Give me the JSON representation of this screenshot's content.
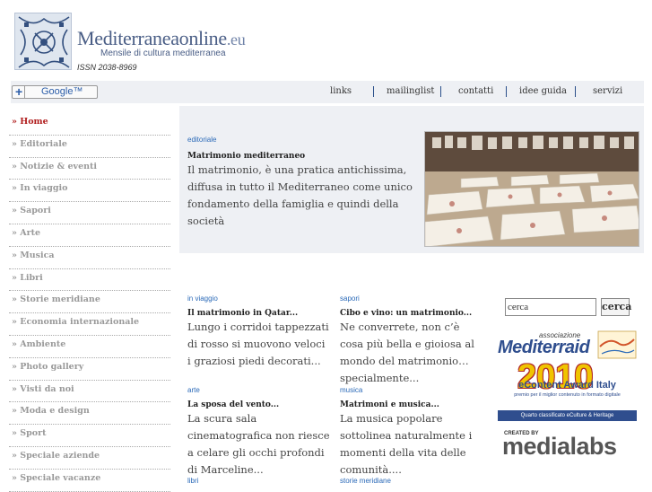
{
  "header": {
    "site_name": "Mediterraneaonline",
    "site_tld": ".eu",
    "subtitle": "Mensile di cultura mediterranea",
    "issn": "ISSN 2038-8969"
  },
  "topbar": {
    "google_button": "Google™",
    "nav": [
      "links",
      "mailinglist",
      "contatti",
      "idee guida",
      "servizi"
    ]
  },
  "sidebar": {
    "items": [
      "» Home",
      "» Editoriale",
      "» Notizie & eventi",
      "» In viaggio",
      "» Sapori",
      "» Arte",
      "» Musica",
      "» Libri",
      "» Storie meridiane",
      "» Economia internazionale",
      "» Ambiente",
      "» Photo gallery",
      "» Visti da noi",
      "» Moda e design",
      "» Sport",
      "» Speciale aziende",
      "» Speciale vacanze"
    ]
  },
  "featured": {
    "category": "editoriale",
    "title": "Matrimonio mediterraneo",
    "text": "Il matrimonio, è una pratica antichissima, diffusa in tutto il Mediterraneo come unico fondamento della famiglia e quindi della società"
  },
  "articles": [
    {
      "category": "in viaggio",
      "title": "Il matrimonio in Qatar...",
      "text": "Lungo i corridoi tappezzati di rosso si muovono veloci i graziosi piedi decorati..."
    },
    {
      "category": "sapori",
      "title": "Cibo e vino: un matrimonio...",
      "text": "Ne converrete, non c’è cosa più bella e gioiosa al mondo del matrimonio…specialmente..."
    },
    {
      "category": "arte",
      "title": "La sposa del vento...",
      "text": "La scura sala cinematografica non riesce a celare gli occhi profondi di Marceline..."
    },
    {
      "category": "musica",
      "title": "Matrimoni e musica...",
      "text": "La musica popolare sottolinea naturalmente i momenti della vita delle comunità...."
    },
    {
      "category": "libri",
      "title": "",
      "text": ""
    },
    {
      "category": "storie meridiane",
      "title": "",
      "text": ""
    }
  ],
  "search": {
    "value": "cerca",
    "button": "cerca"
  },
  "banners": {
    "mediterraid_top": "associazione",
    "mediterraid_name": "Mediterraid",
    "award_year": "2010",
    "award_title": "eContent Award Italy",
    "award_line": "premio per il miglior contenuto in formato digitale",
    "award_class": "Quarto classificato eCulture & Heritage",
    "medialabs_small": "CREATED BY",
    "medialabs_name": "medialabs"
  },
  "colors": {
    "accent_blue": "#2b6ab8",
    "active_red": "#b01c1c",
    "panel_bg": "#eef0f4"
  }
}
